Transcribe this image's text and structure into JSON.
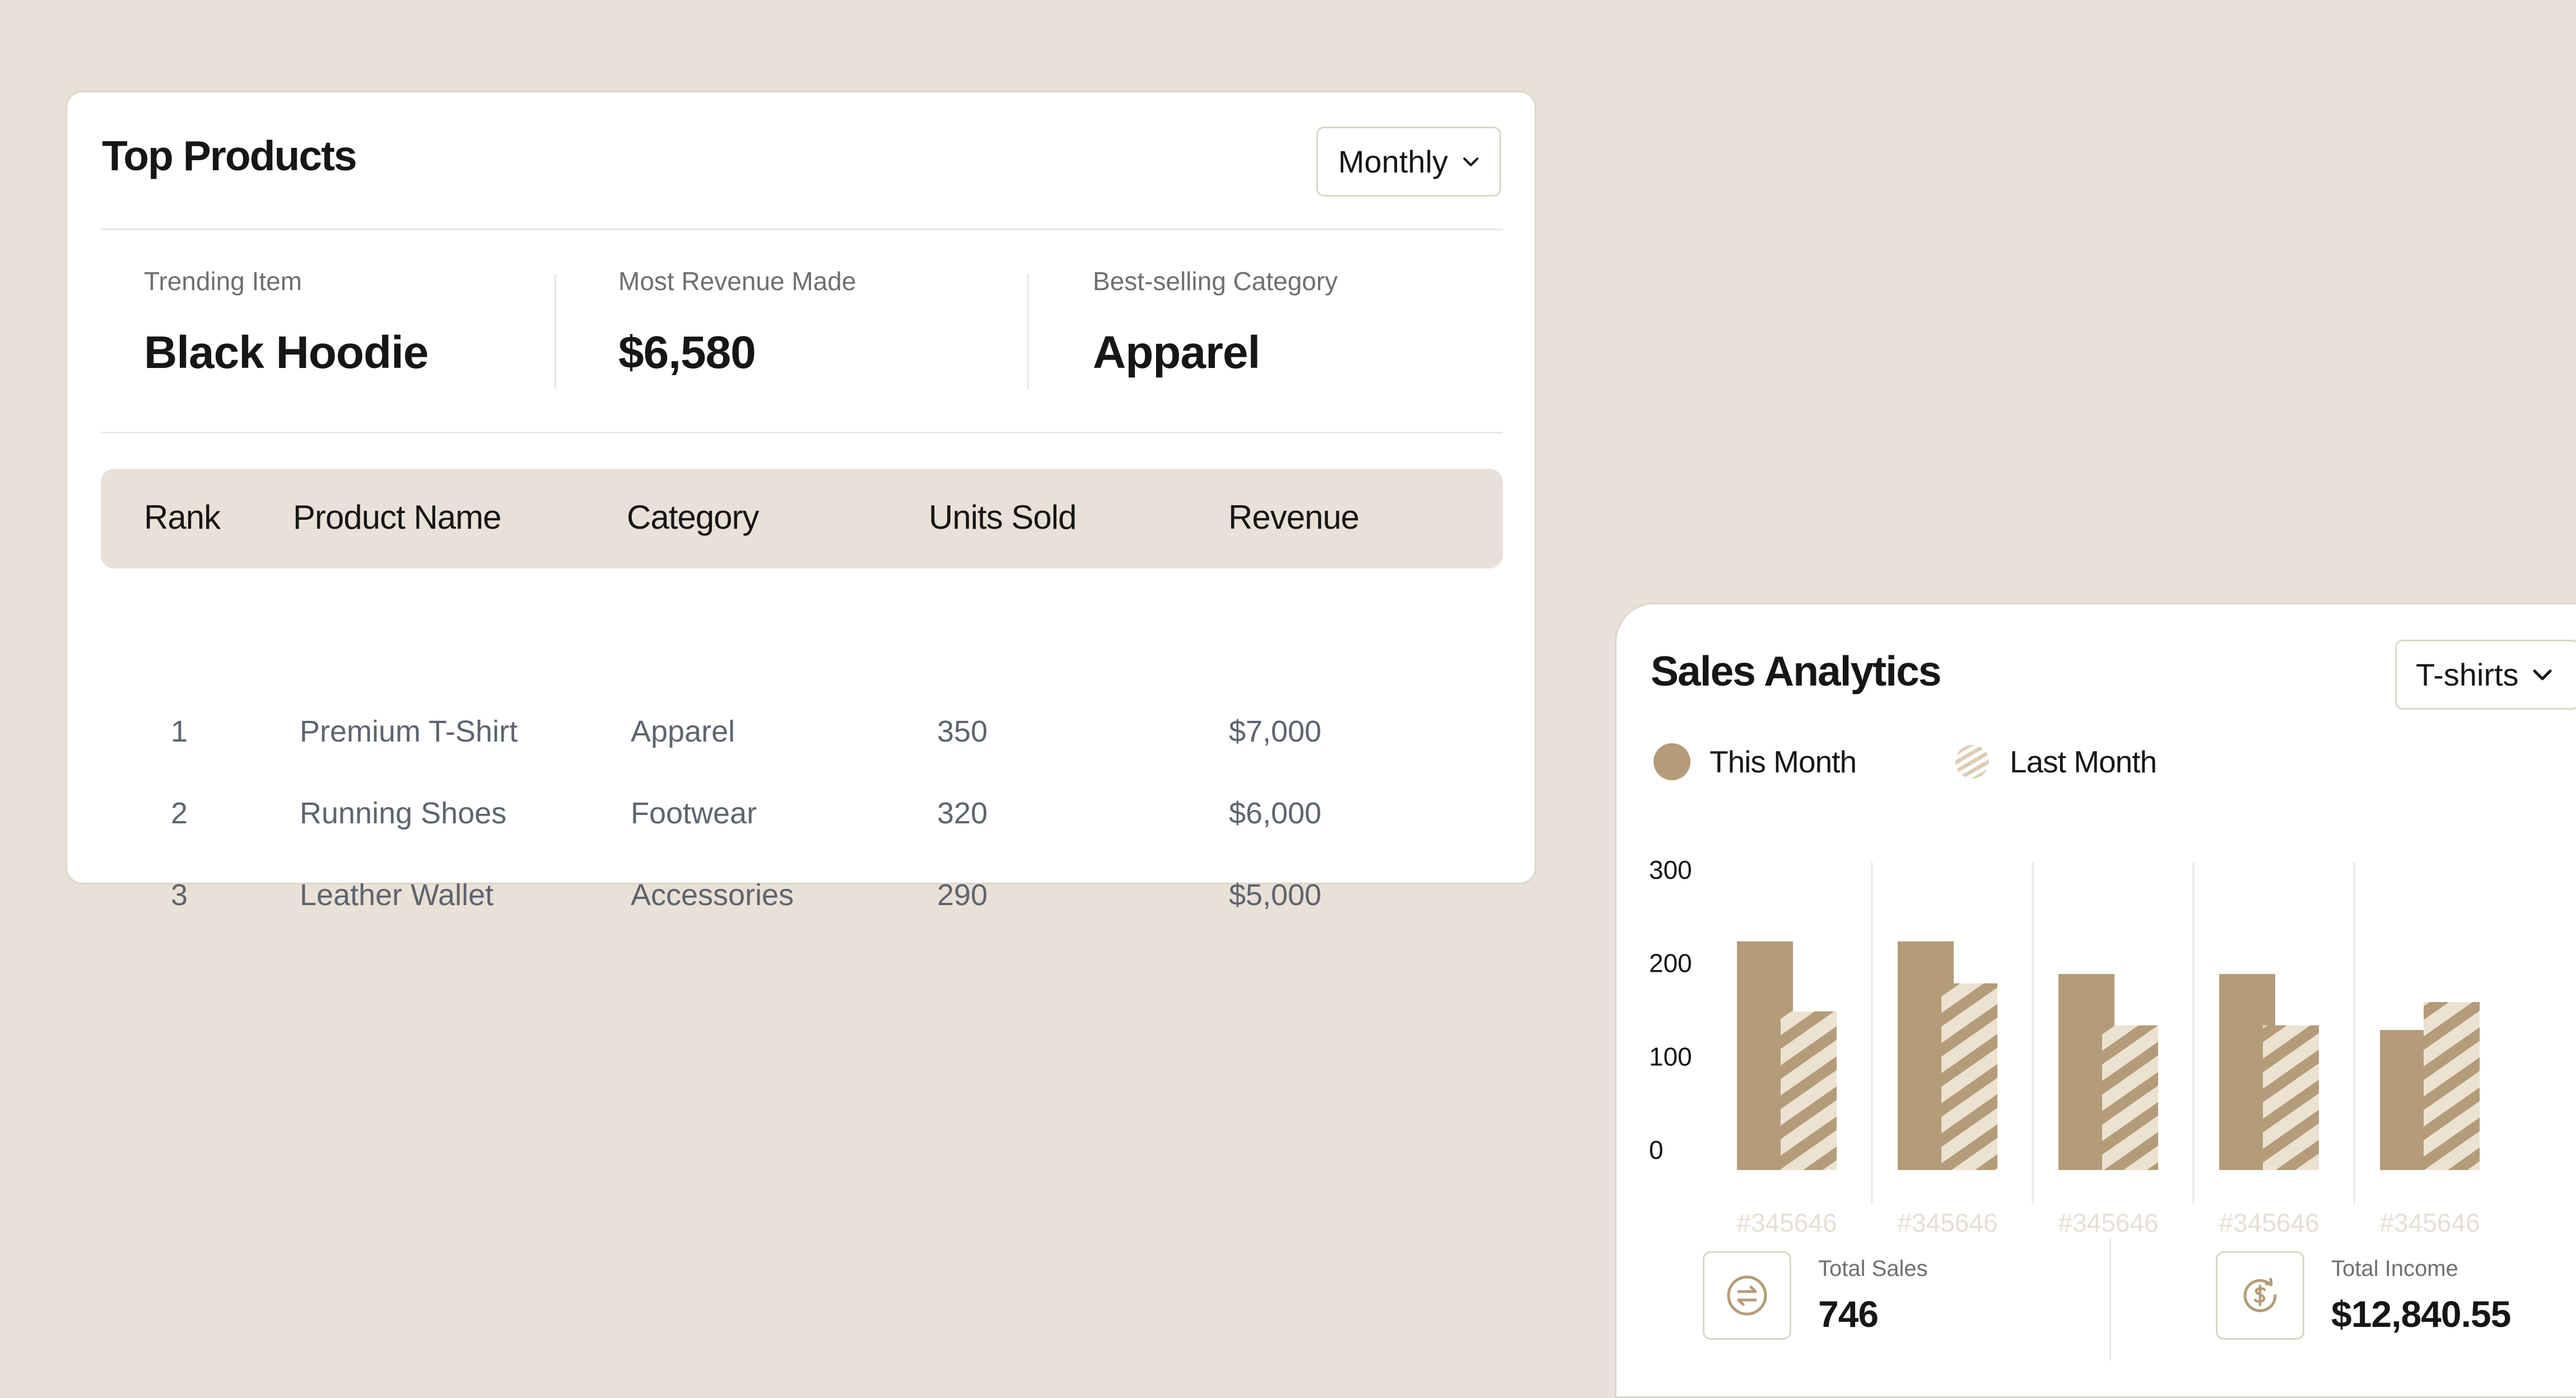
{
  "top_products": {
    "title": "Top Products",
    "period_select": "Monthly",
    "highlights": [
      {
        "label": "Trending Item",
        "value": "Black Hoodie"
      },
      {
        "label": "Most Revenue Made",
        "value": "$6,580"
      },
      {
        "label": "Best-selling Category",
        "value": "Apparel"
      }
    ],
    "columns": [
      "Rank",
      "Product Name",
      "Category",
      "Units Sold",
      "Revenue"
    ],
    "rows": [
      {
        "rank": "1",
        "product": "Premium T-Shirt",
        "category": "Apparel",
        "units": "350",
        "revenue": "$7,000"
      },
      {
        "rank": "2",
        "product": "Running Shoes",
        "category": "Footwear",
        "units": "320",
        "revenue": "$6,000"
      },
      {
        "rank": "3",
        "product": "Leather Wallet",
        "category": "Accessories",
        "units": "290",
        "revenue": "$5,000"
      }
    ]
  },
  "sales_analytics": {
    "title": "Sales Analytics",
    "product_select": "T-shirts",
    "legend": [
      "This Month",
      "Last Month"
    ],
    "totals": [
      {
        "label": "Total Sales",
        "value": "746",
        "icon": "exchange-circle-icon"
      },
      {
        "label": "Total Income",
        "value": "$12,840.55",
        "icon": "dollar-refresh-icon"
      }
    ]
  },
  "colors": {
    "background": "#e9e1d7",
    "accent": "#b49c78",
    "accent_light": "#ece2d2",
    "x_label": "#e6dfd4"
  },
  "chart_data": {
    "type": "bar",
    "categories": [
      "#345646",
      "#345646",
      "#345646",
      "#345646",
      "#345646"
    ],
    "series": [
      {
        "name": "This Month",
        "values": [
          245,
          245,
          210,
          210,
          150
        ]
      },
      {
        "name": "Last Month",
        "values": [
          170,
          200,
          155,
          155,
          180
        ]
      }
    ],
    "y_ticks": [
      "300",
      "200",
      "100",
      "0"
    ],
    "ylim": [
      0,
      300
    ],
    "grid": "vertical separators",
    "legend_position": "top-left"
  }
}
